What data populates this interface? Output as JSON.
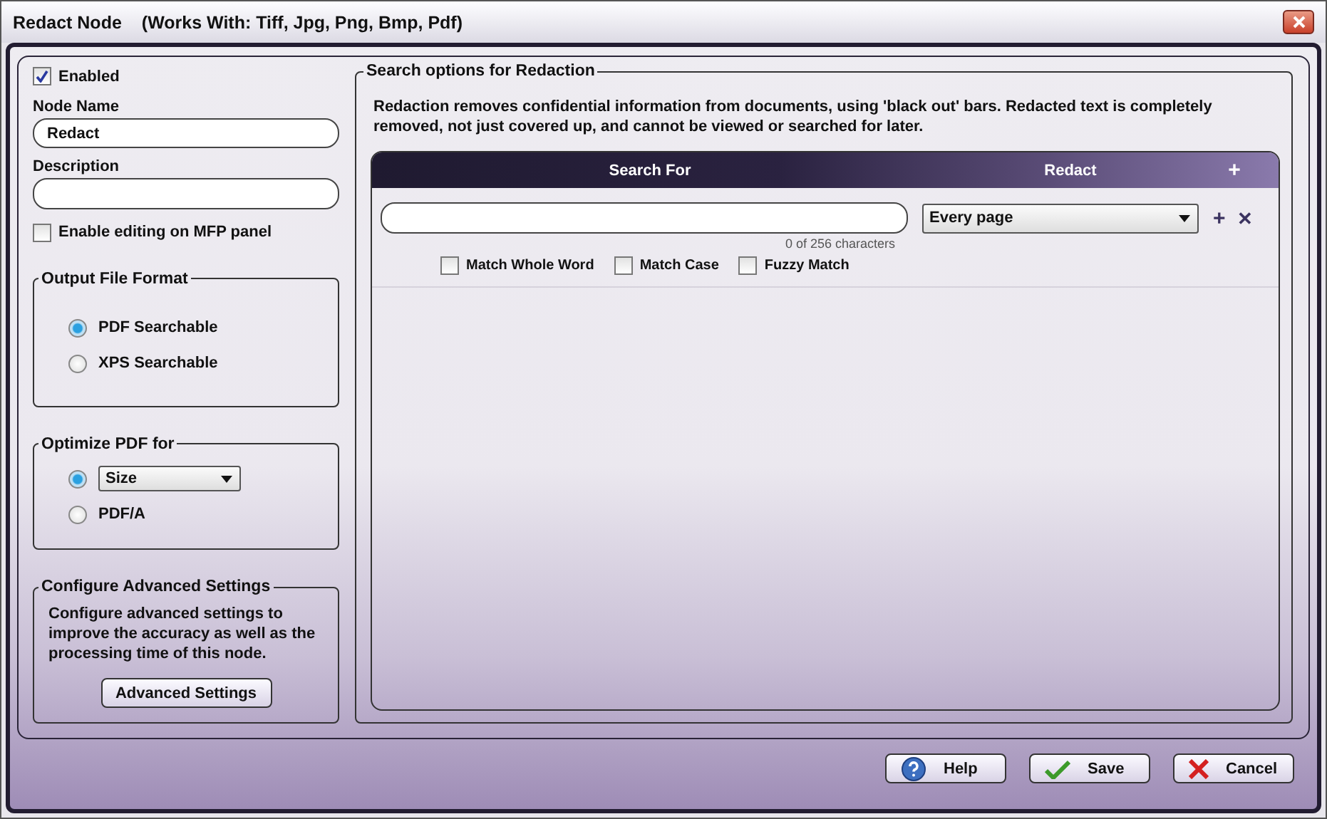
{
  "window": {
    "title": "Redact Node",
    "subtitle": "(Works With: Tiff, Jpg, Png, Bmp, Pdf)"
  },
  "enabled": {
    "label": "Enabled",
    "checked": true
  },
  "node_name": {
    "label": "Node Name",
    "value": "Redact"
  },
  "description": {
    "label": "Description"
  },
  "mfp_editing": {
    "label": "Enable editing on MFP panel",
    "checked": false
  },
  "output_format": {
    "title": "Output File Format",
    "options": [
      {
        "kind": "label",
        "label": "PDF Searchable",
        "selected": true
      },
      {
        "kind": "label",
        "label": "XPS Searchable",
        "selected": false
      }
    ]
  },
  "optimize": {
    "title": "Optimize PDF for",
    "options": [
      {
        "kind": "dropdown",
        "value": "Size",
        "selected": true
      },
      {
        "kind": "label",
        "label": "PDF/A",
        "selected": false
      }
    ]
  },
  "advanced": {
    "title": "Configure Advanced Settings",
    "text": "Configure advanced settings to improve the accuracy as well as the processing time of this node.",
    "button": "Advanced Settings"
  },
  "search": {
    "title": "Search options for Redaction",
    "intro": "Redaction removes confidential information from documents, using 'black out' bars. Redacted text is completely removed, not just covered up, and cannot be viewed or searched for later.",
    "columns": [
      "Search For",
      "Redact"
    ],
    "add": "+",
    "rows": [
      {
        "counter": "0 of 256 characters",
        "redact": "Every page",
        "add": "+",
        "remove": "✕",
        "options": [
          {
            "label": "Match Whole Word",
            "checked": false
          },
          {
            "label": "Match Case",
            "checked": false
          },
          {
            "label": "Fuzzy Match",
            "checked": false
          }
        ]
      }
    ]
  },
  "buttons": [
    {
      "kind": "help",
      "label": "Help"
    },
    {
      "kind": "save",
      "label": "Save"
    },
    {
      "kind": "cancel",
      "label": "Cancel"
    }
  ]
}
